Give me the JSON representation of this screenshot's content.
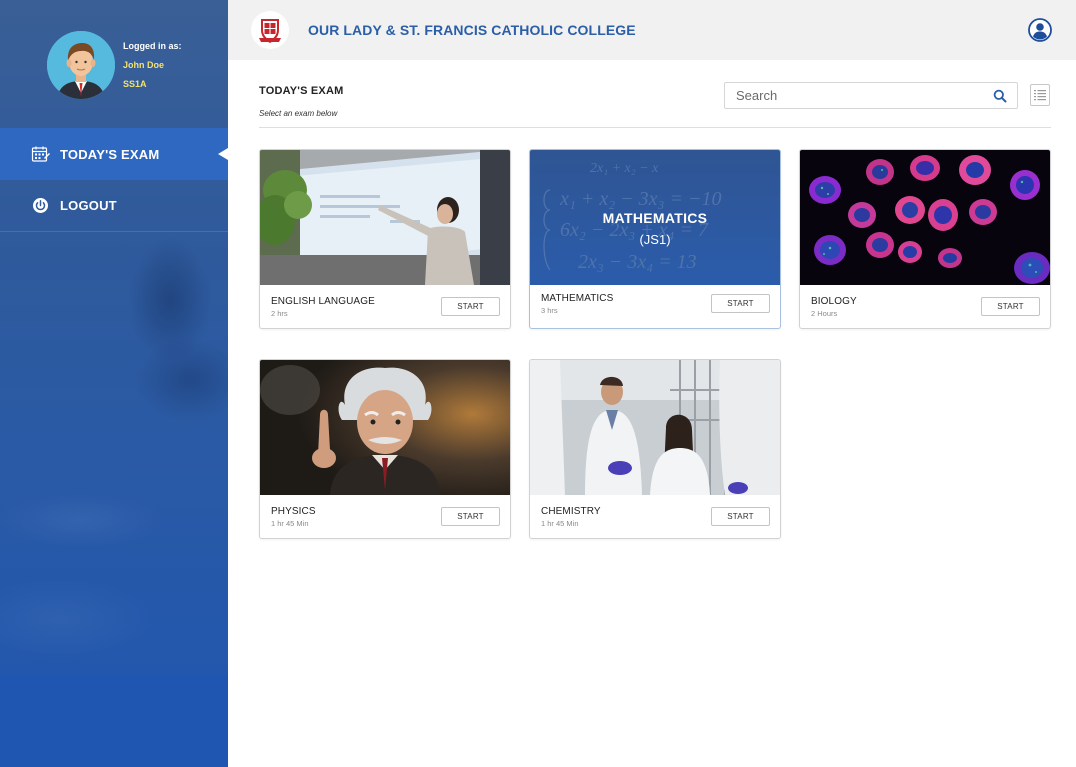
{
  "sidebar": {
    "user": {
      "logged_in_label": "Logged in as:",
      "name": "John Doe",
      "class": "SS1A"
    },
    "nav": [
      {
        "label": "TODAY'S EXAM",
        "icon": "calendar-icon",
        "active": true
      },
      {
        "label": "LOGOUT",
        "icon": "power-icon",
        "active": false
      }
    ]
  },
  "header": {
    "school_name": "OUR LADY & ST. FRANCIS CATHOLIC COLLEGE",
    "logo_icon": "school-crest-icon",
    "profile_icon": "user-profile-icon"
  },
  "main": {
    "title": "TODAY'S EXAM",
    "subtitle": "Select an exam below",
    "search": {
      "placeholder": "Search",
      "icon": "search-icon"
    },
    "view_toggle_icon": "list-view-icon",
    "exams": [
      {
        "subject": "ENGLISH LANGUAGE",
        "duration": "2 hrs",
        "button": "START",
        "image": "classroom-presentation"
      },
      {
        "subject": "MATHEMATICS",
        "duration": "3 hrs",
        "button": "START",
        "image": "math-equations",
        "overlay_title": "MATHEMATICS",
        "overlay_subtitle": "(JS1)"
      },
      {
        "subject": "BIOLOGY",
        "duration": "2 Hours",
        "button": "START",
        "image": "cells-microscopy"
      },
      {
        "subject": "PHYSICS",
        "duration": "1 hr 45 Min",
        "button": "START",
        "image": "einstein-figurine"
      },
      {
        "subject": "CHEMISTRY",
        "duration": "1 hr 45 Min",
        "button": "START",
        "image": "lab-scientists"
      }
    ]
  },
  "colors": {
    "sidebar": "#2f5a9b",
    "active_nav": "#2f68c0",
    "brand_blue": "#2a5ea7",
    "accent_yellow": "#f4e26b"
  }
}
